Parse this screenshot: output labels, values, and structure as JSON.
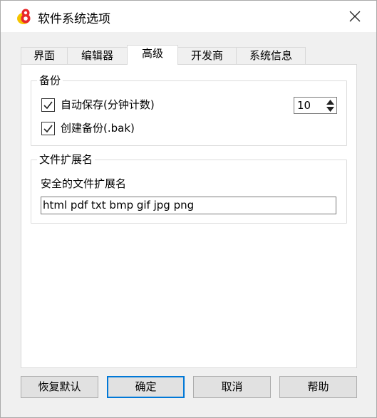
{
  "window": {
    "title": "软件系统选项",
    "icon": "app-logo-icon",
    "close_icon": "close-icon"
  },
  "tabs": [
    {
      "label": "界面"
    },
    {
      "label": "编辑器"
    },
    {
      "label": "高级",
      "active": true
    },
    {
      "label": "开发商"
    },
    {
      "label": "系统信息"
    }
  ],
  "backup_group": {
    "title": "备份",
    "autosave": {
      "label": "自动保存(分钟计数)",
      "checked": true,
      "value": "10"
    },
    "create_backup": {
      "label": "创建备份(.bak)",
      "checked": true
    }
  },
  "ext_group": {
    "title": "文件扩展名",
    "safe_label": "安全的文件扩展名",
    "safe_value": "html pdf txt bmp gif jpg png"
  },
  "buttons": {
    "restore_default": "恢复默认",
    "ok": "确定",
    "cancel": "取消",
    "help": "帮助"
  },
  "colors": {
    "accent": "#0078d7",
    "logo_red": "#e8282b",
    "logo_yellow": "#f5c400"
  }
}
